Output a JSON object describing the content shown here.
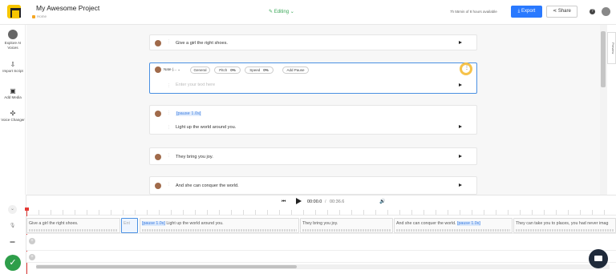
{
  "header": {
    "project_title": "My Awesome Project",
    "breadcrumb": "Home",
    "mode": "Editing",
    "quota": "7h 55min of 8 hours available",
    "export_label": "Export",
    "share_label": "Share",
    "help": "?"
  },
  "sidebar": {
    "items": [
      {
        "label": "Explore AI Voices"
      },
      {
        "label": "Import Script"
      },
      {
        "label": "Add Media"
      },
      {
        "label": "Voice Changer"
      }
    ]
  },
  "blocks": [
    {
      "text": "Give a girl the right shoes."
    },
    {
      "voice": "Nate (...",
      "style": "General",
      "pitch_label": "Pitch",
      "pitch": "0%",
      "speed_label": "Speed",
      "speed": "0%",
      "add_pause": "Add Pause",
      "placeholder": "Enter your text here"
    },
    {
      "pause": "[pause 1.0s]",
      "text": "Light up the world around you."
    },
    {
      "text": "They bring you joy."
    },
    {
      "text": "And she can conquer the world."
    }
  ],
  "preview_tab": "Preview",
  "transport": {
    "current": "00:00.0",
    "separator": "/",
    "total": "00:36.6"
  },
  "timeline": {
    "segments": [
      {
        "text": "Give a girl the right shoes."
      },
      {
        "text": "Ent"
      },
      {
        "pause": "[pause 1.0s]",
        "text": "Light up the world around you."
      },
      {
        "text": "They bring you joy."
      },
      {
        "text": "And she can conquer the world.",
        "pause": "[pause 1.0s]"
      },
      {
        "text": "They can take you to places, you had never imag"
      }
    ]
  },
  "colors": {
    "accent": "#2979ff",
    "editing": "#3aa757",
    "highlight": "#f6c24a",
    "playhead": "#e53935"
  }
}
